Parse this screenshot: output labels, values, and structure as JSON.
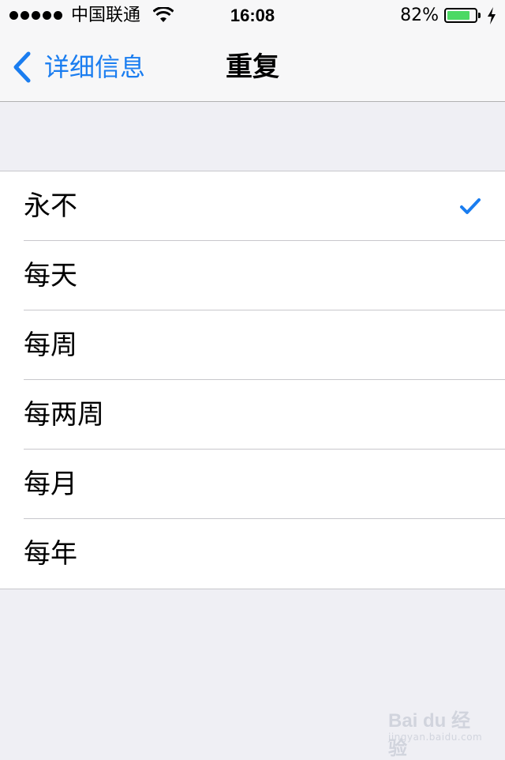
{
  "status_bar": {
    "carrier": "中国联通",
    "time": "16:08",
    "battery_percent_text": "82%",
    "battery_level": 0.82,
    "signal_bars": 5,
    "wifi_icon": "wifi-icon",
    "charging_icon": "bolt-icon"
  },
  "nav": {
    "back_label": "详细信息",
    "title": "重复",
    "back_icon": "chevron-left-icon"
  },
  "options": [
    {
      "label": "永不",
      "selected": true
    },
    {
      "label": "每天",
      "selected": false
    },
    {
      "label": "每周",
      "selected": false
    },
    {
      "label": "每两周",
      "selected": false
    },
    {
      "label": "每月",
      "selected": false
    },
    {
      "label": "每年",
      "selected": false
    }
  ],
  "watermark": {
    "brand": "Bai du 经验",
    "url": "jingyan.baidu.com"
  },
  "colors": {
    "accent": "#1a7df0",
    "battery": "#4cd964",
    "background": "#efeff4"
  }
}
